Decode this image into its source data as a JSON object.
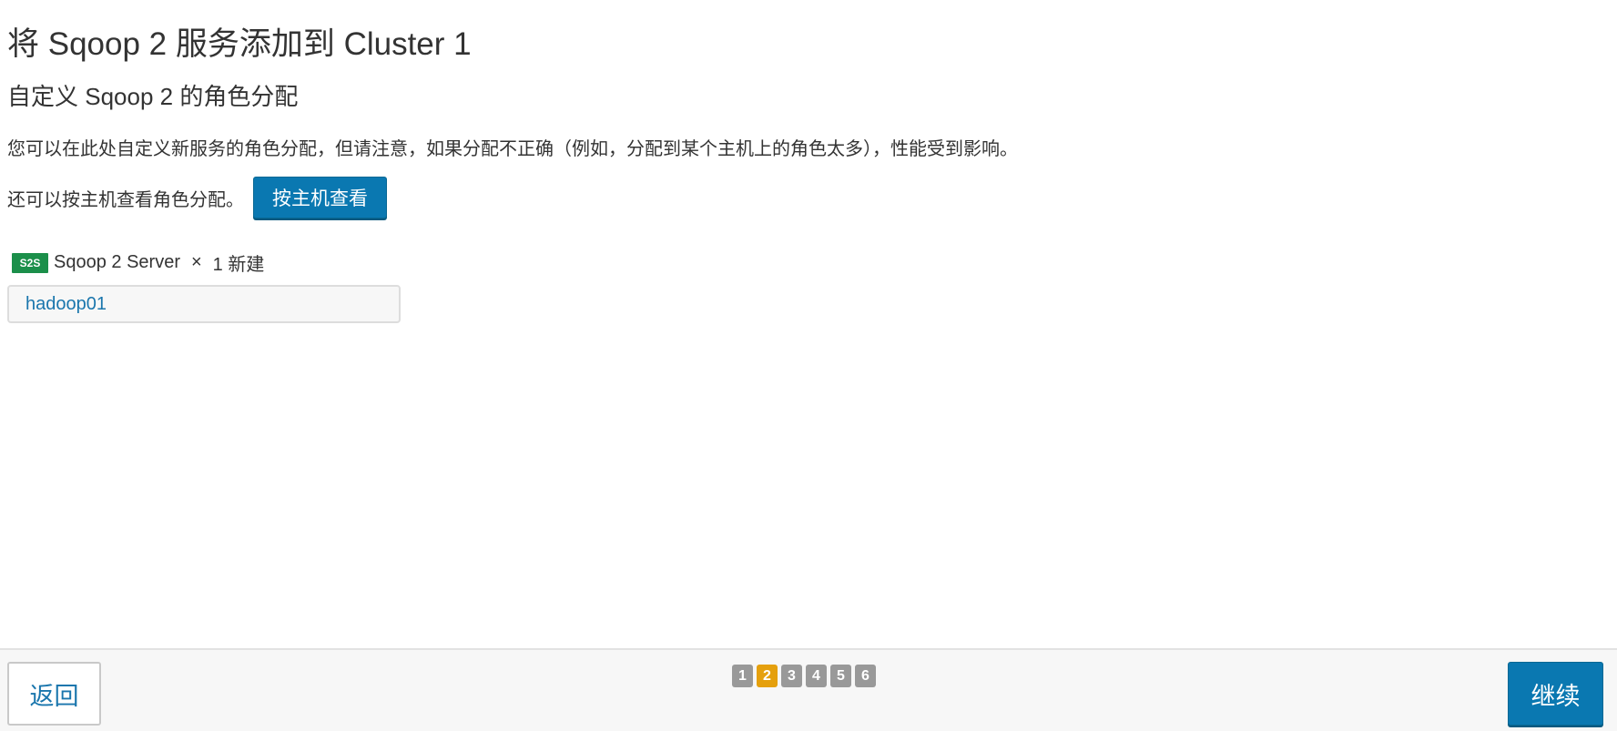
{
  "page": {
    "title": "将 Sqoop 2 服务添加到 Cluster 1",
    "subtitle": "自定义 Sqoop 2 的角色分配",
    "description": "您可以在此处自定义新服务的角色分配，但请注意，如果分配不正确（例如，分配到某个主机上的角色太多），性能受到影响。",
    "host_view_text": "还可以按主机查看角色分配。",
    "host_view_button": "按主机查看"
  },
  "role": {
    "badge": "S2S",
    "name": "Sqoop 2 Server",
    "times": "×",
    "count": "1 新建",
    "host": "hadoop01",
    "badge_color": "#1b8f4a"
  },
  "footer": {
    "back_label": "返回",
    "continue_label": "继续",
    "steps": [
      {
        "label": "1"
      },
      {
        "label": "2"
      },
      {
        "label": "3"
      },
      {
        "label": "4"
      },
      {
        "label": "5"
      },
      {
        "label": "6"
      }
    ],
    "active_step": "2"
  },
  "colors": {
    "primary": "#0a78b1",
    "link": "#1a76ad",
    "step_active": "#e5a00d",
    "step_inactive": "#999999"
  }
}
